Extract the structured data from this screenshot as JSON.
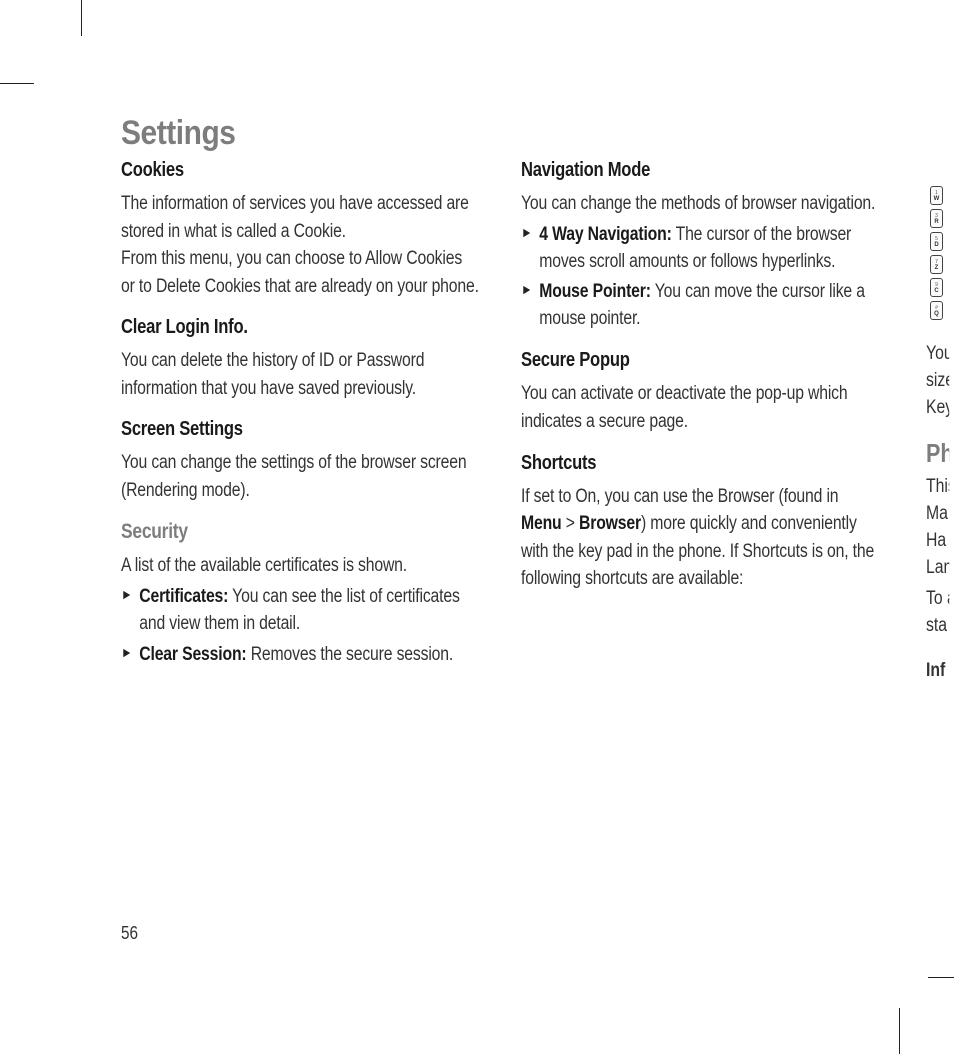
{
  "page_title": "Settings",
  "page_number": "56",
  "left": {
    "cookies": {
      "heading": "Cookies",
      "p1": "The information of services you have accessed are stored in what is called a Cookie.",
      "p2": "From this menu, you can choose to Allow Cookies or to Delete Cookies that are already on your phone."
    },
    "clear_login": {
      "heading": "Clear Login Info.",
      "p": "You can delete the history of ID or Password information that you have saved  previously."
    },
    "screen_settings": {
      "heading": "Screen Settings",
      "p": "You can change the settings of the browser screen (Rendering mode)."
    },
    "security": {
      "heading": "Security",
      "p": "A list of the available certificates is shown.",
      "items": [
        {
          "bold": "Certificates:",
          "rest": " You can see the list of certificates and view them in detail."
        },
        {
          "bold": "Clear Session:",
          "rest": " Removes the secure session."
        }
      ]
    }
  },
  "right": {
    "nav_mode": {
      "heading": "Navigation Mode",
      "p": "You can change the methods of browser navigation.",
      "items": [
        {
          "bold": "4 Way Navigation:",
          "rest": " The cursor of the browser moves scroll amounts or follows hyperlinks."
        },
        {
          "bold": "Mouse Pointer:",
          "rest": " You can move the cursor like a mouse pointer."
        }
      ]
    },
    "secure_popup": {
      "heading": "Secure Popup",
      "p": "You can activate or deactivate the pop-up which indicates a secure page."
    },
    "shortcuts": {
      "heading": "Shortcuts",
      "p1_a": "If set to On, you can use the Browser (found in ",
      "p1_menu": "Menu",
      "p1_gt": " > ",
      "p1_browser": "Browser",
      "p1_b": ") more quickly and conveniently with the key pad in the phone. If Shortcuts is on, the following shortcuts are available:"
    }
  },
  "next_page_peek": {
    "keys": [
      {
        "num": "1",
        "ch": "W"
      },
      {
        "num": "3",
        "ch": "R"
      },
      {
        "num": "5",
        "ch": "D"
      },
      {
        "num": "7",
        "ch": "Z"
      },
      {
        "num": "9",
        "ch": "C"
      },
      {
        "num": "#",
        "ch": "Q"
      }
    ],
    "lines": [
      "You",
      "size",
      "Key"
    ],
    "ph": "Ph",
    "lines2": [
      "This",
      "Ma",
      "Ha",
      "Lan",
      "To a",
      "sta"
    ],
    "inf": "Inf"
  }
}
